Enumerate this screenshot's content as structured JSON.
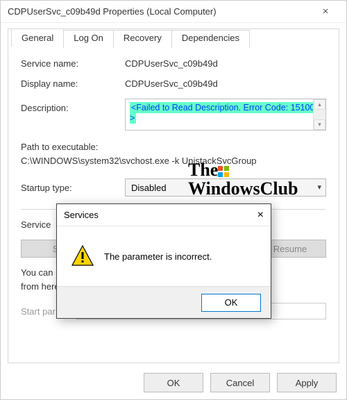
{
  "window": {
    "title": "CDPUserSvc_c09b49d Properties (Local Computer)",
    "close_glyph": "×"
  },
  "tabs": {
    "general": "General",
    "logon": "Log On",
    "recovery": "Recovery",
    "dependencies": "Dependencies"
  },
  "fields": {
    "service_name_label": "Service name:",
    "service_name": "CDPUserSvc_c09b49d",
    "display_name_label": "Display name:",
    "display_name": "CDPUserSvc_c09b49d",
    "description_label": "Description:",
    "description_value": "<Failed to Read Description. Error Code: 15100 >",
    "path_label": "Path to executable:",
    "path_value": "C:\\WINDOWS\\system32\\svchost.exe -k UnistackSvcGroup",
    "startup_label": "Startup type:",
    "startup_value": "Disabled",
    "service_status_label": "Service",
    "hint": "You can                                                                                 rt the service\nfrom here",
    "start_params_label": "Start par"
  },
  "service_buttons": {
    "start": "St",
    "resume": "Resume"
  },
  "bottom_buttons": {
    "ok": "OK",
    "cancel": "Cancel",
    "apply": "Apply"
  },
  "modal": {
    "title": "Services",
    "close_glyph": "×",
    "message": "The parameter is incorrect.",
    "ok": "OK"
  },
  "watermark": {
    "line1": "The",
    "line2": "WindowsClub"
  }
}
